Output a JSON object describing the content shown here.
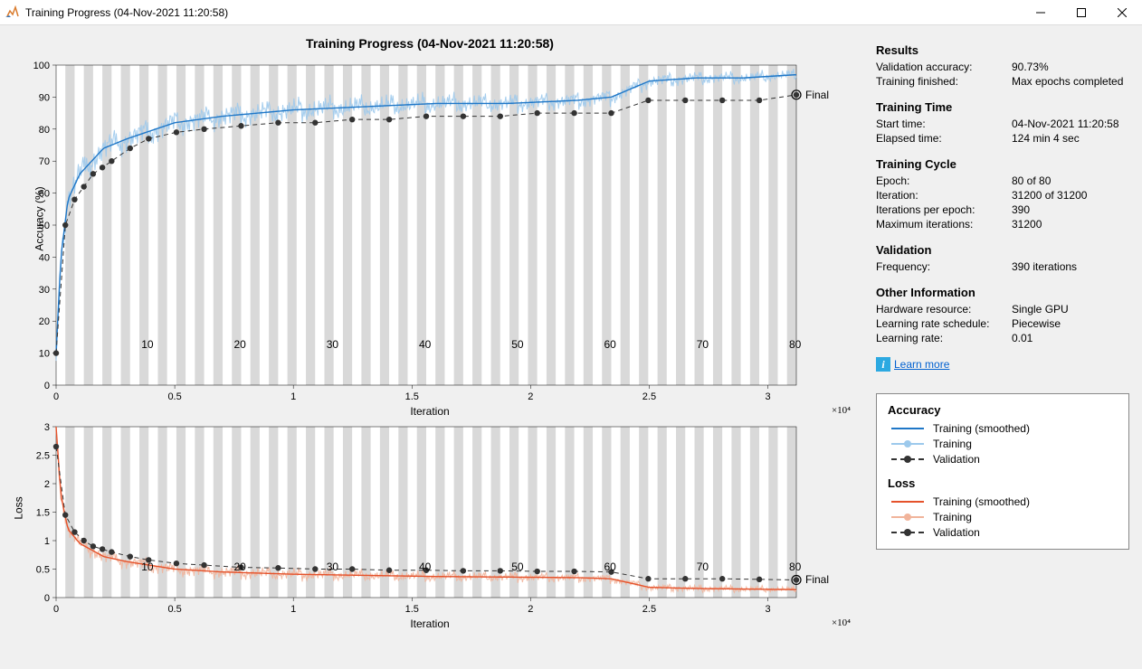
{
  "window": {
    "title": "Training Progress (04-Nov-2021 11:20:58)"
  },
  "plot_title": "Training Progress (04-Nov-2021 11:20:58)",
  "charts": {
    "accuracy": {
      "ylabel": "Accuracy (%)",
      "xlabel": "Iteration",
      "x_exponent": "×10⁴",
      "final_label": "Final"
    },
    "loss": {
      "ylabel": "Loss",
      "xlabel": "Iteration",
      "x_exponent": "×10⁴",
      "final_label": "Final"
    }
  },
  "epoch_ticks": [
    "10",
    "20",
    "30",
    "40",
    "50",
    "60",
    "70",
    "80"
  ],
  "side": {
    "results_hdr": "Results",
    "val_acc_key": "Validation accuracy:",
    "val_acc_val": "90.73%",
    "train_fin_key": "Training finished:",
    "train_fin_val": "Max epochs completed",
    "time_hdr": "Training Time",
    "start_key": "Start time:",
    "start_val": "04-Nov-2021 11:20:58",
    "elapsed_key": "Elapsed time:",
    "elapsed_val": "124 min 4 sec",
    "cycle_hdr": "Training Cycle",
    "epoch_key": "Epoch:",
    "epoch_val": "80 of 80",
    "iter_key": "Iteration:",
    "iter_val": "31200 of 31200",
    "ipe_key": "Iterations per epoch:",
    "ipe_val": "390",
    "maxit_key": "Maximum iterations:",
    "maxit_val": "31200",
    "valid_hdr": "Validation",
    "freq_key": "Frequency:",
    "freq_val": "390 iterations",
    "other_hdr": "Other Information",
    "hw_key": "Hardware resource:",
    "hw_val": "Single GPU",
    "lrs_key": "Learning rate schedule:",
    "lrs_val": "Piecewise",
    "lr_key": "Learning rate:",
    "lr_val": "0.01",
    "learn_more": "Learn more"
  },
  "legend": {
    "acc_hdr": "Accuracy",
    "loss_hdr": "Loss",
    "train_smooth": "Training (smoothed)",
    "train": "Training",
    "valid": "Validation"
  },
  "chart_data": [
    {
      "type": "line",
      "title": "Accuracy (%)",
      "xlabel": "Iteration",
      "ylabel": "Accuracy (%)",
      "xlim": [
        0,
        31200
      ],
      "ylim": [
        0,
        100
      ],
      "x_ticks": [
        0,
        5000.0,
        10000.0,
        15000.0,
        20000.0,
        25000.0,
        30000.0
      ],
      "x_tick_labels": [
        "0",
        "0.5",
        "1",
        "1.5",
        "2",
        "2.5",
        "3"
      ],
      "y_ticks": [
        0,
        10,
        20,
        30,
        40,
        50,
        60,
        70,
        80,
        90,
        100
      ],
      "epoch_ticks_x": [
        3900,
        7800,
        11700,
        15600,
        19500,
        23400,
        27300,
        31200
      ],
      "epoch_tick_labels": [
        "10",
        "20",
        "30",
        "40",
        "50",
        "60",
        "70",
        "80"
      ],
      "series": [
        {
          "name": "Training (smoothed)",
          "color": "#1f77c7",
          "x": [
            0,
            200,
            500,
            1000,
            2000,
            3000,
            5000,
            7000,
            10000,
            13000,
            16000,
            19000,
            22000,
            23400,
            25000,
            27000,
            29000,
            31200
          ],
          "values": [
            10,
            40,
            58,
            66,
            74,
            77,
            82,
            84,
            86,
            87,
            88,
            88,
            89,
            90,
            95,
            96,
            96,
            97
          ]
        },
        {
          "name": "Training",
          "color": "#9cc9ec",
          "note": "noisy variant around smoothed line, amplitude decreases ~±5% early to ~±2% late"
        },
        {
          "name": "Validation",
          "color": "#333333",
          "style": "dashed-markers",
          "x": [
            0,
            390,
            780,
            1170,
            1560,
            1950,
            2340,
            3120,
            3900,
            5070,
            6240,
            7800,
            9360,
            10920,
            12480,
            14040,
            15600,
            17160,
            18720,
            20280,
            21840,
            23400,
            24960,
            26520,
            28080,
            29640,
            31200
          ],
          "values": [
            10,
            50,
            58,
            62,
            66,
            68,
            70,
            74,
            77,
            79,
            80,
            81,
            82,
            82,
            83,
            83,
            84,
            84,
            84,
            85,
            85,
            85,
            89,
            89,
            89,
            89,
            90.7
          ]
        }
      ],
      "final_value_marker": {
        "x": 31200,
        "y": 90.73,
        "label": "Final"
      }
    },
    {
      "type": "line",
      "title": "Loss",
      "xlabel": "Iteration",
      "ylabel": "Loss",
      "xlim": [
        0,
        31200
      ],
      "ylim": [
        0,
        3
      ],
      "x_ticks": [
        0,
        5000.0,
        10000.0,
        15000.0,
        20000.0,
        25000.0,
        30000.0
      ],
      "x_tick_labels": [
        "0",
        "0.5",
        "1",
        "1.5",
        "2",
        "2.5",
        "3"
      ],
      "y_ticks": [
        0,
        0.5,
        1,
        1.5,
        2,
        2.5,
        3
      ],
      "epoch_ticks_x": [
        3900,
        7800,
        11700,
        15600,
        19500,
        23400,
        27300,
        31200
      ],
      "epoch_tick_labels": [
        "10",
        "20",
        "30",
        "40",
        "50",
        "60",
        "70",
        "80"
      ],
      "series": [
        {
          "name": "Training (smoothed)",
          "color": "#e5522b",
          "x": [
            0,
            200,
            500,
            1000,
            2000,
            3000,
            5000,
            7000,
            10000,
            13000,
            16000,
            19000,
            22000,
            23400,
            25000,
            27000,
            29000,
            31200
          ],
          "values": [
            3.0,
            1.8,
            1.2,
            0.95,
            0.72,
            0.63,
            0.5,
            0.45,
            0.41,
            0.39,
            0.37,
            0.36,
            0.35,
            0.33,
            0.18,
            0.16,
            0.15,
            0.14
          ]
        },
        {
          "name": "Training",
          "color": "#f1b49b",
          "note": "noisy variant around smoothed line"
        },
        {
          "name": "Validation",
          "color": "#333333",
          "style": "dashed-markers",
          "x": [
            0,
            390,
            780,
            1170,
            1560,
            1950,
            2340,
            3120,
            3900,
            5070,
            6240,
            7800,
            9360,
            10920,
            12480,
            14040,
            15600,
            17160,
            18720,
            20280,
            21840,
            23400,
            24960,
            26520,
            28080,
            29640,
            31200
          ],
          "values": [
            2.65,
            1.45,
            1.15,
            1.0,
            0.9,
            0.85,
            0.8,
            0.72,
            0.66,
            0.6,
            0.57,
            0.53,
            0.52,
            0.5,
            0.5,
            0.48,
            0.48,
            0.47,
            0.47,
            0.46,
            0.46,
            0.45,
            0.33,
            0.33,
            0.33,
            0.32,
            0.31
          ]
        }
      ],
      "final_value_marker": {
        "x": 31200,
        "y": 0.31,
        "label": "Final"
      }
    }
  ]
}
